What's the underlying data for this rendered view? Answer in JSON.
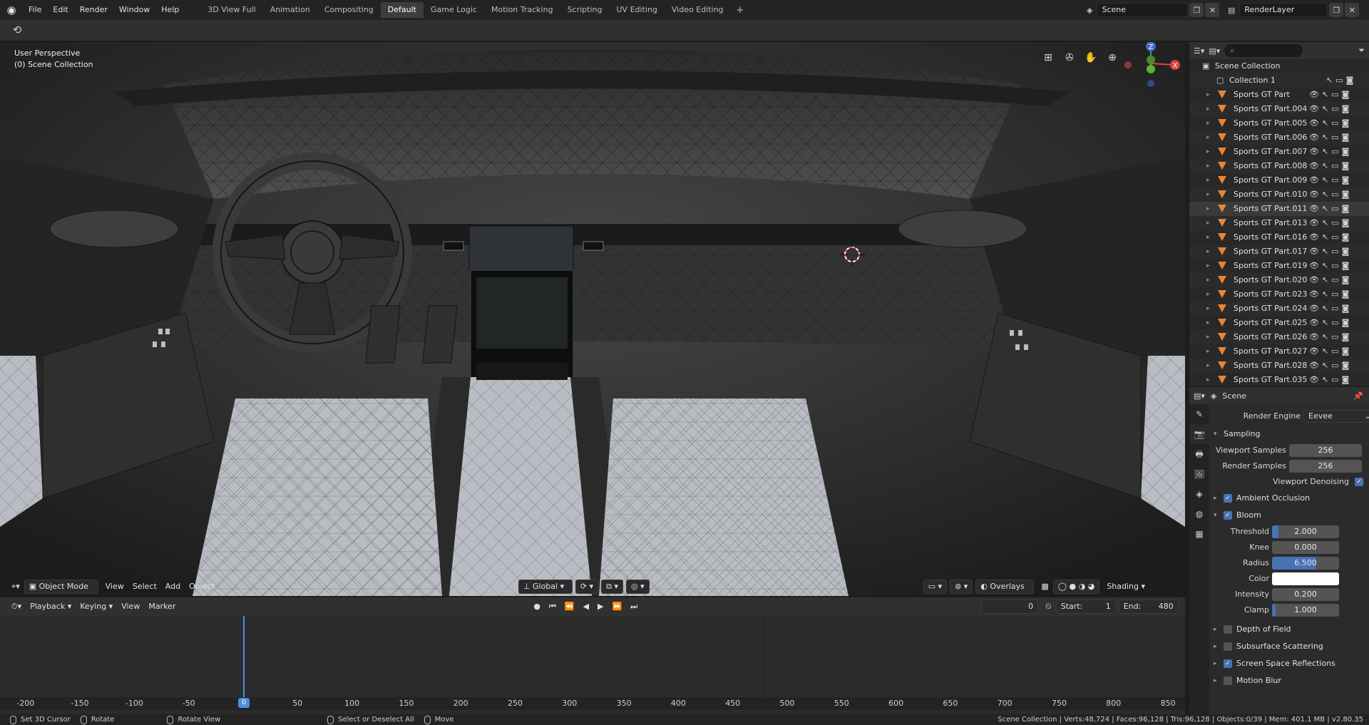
{
  "menus": [
    "File",
    "Edit",
    "Render",
    "Window",
    "Help"
  ],
  "workspaces": [
    "3D View Full",
    "Animation",
    "Compositing",
    "Default",
    "Game Logic",
    "Motion Tracking",
    "Scripting",
    "UV Editing",
    "Video Editing"
  ],
  "active_workspace": "Default",
  "scene_field": "Scene",
  "render_layer_field": "RenderLayer",
  "viewport": {
    "perspective_label": "User Perspective",
    "collection_label": "(0) Scene Collection",
    "mode": "Object Mode",
    "menus": [
      "View",
      "Select",
      "Add",
      "Object"
    ],
    "transform_orientation": "Global",
    "overlays_label": "Overlays",
    "shading_label": "Shading",
    "gizmo_axes": {
      "x": "X",
      "y": "Y",
      "z": "Z"
    }
  },
  "timeline": {
    "menus": [
      "Playback",
      "Keying",
      "View",
      "Marker"
    ],
    "current_frame": "0",
    "start_label": "Start:",
    "start": "1",
    "end_label": "End:",
    "end": "480",
    "ruler_ticks": [
      "-200",
      "-150",
      "-100",
      "-50",
      "0",
      "50",
      "100",
      "150",
      "200",
      "250",
      "300",
      "350",
      "400",
      "450",
      "500",
      "550",
      "600",
      "650",
      "700",
      "750",
      "800",
      "850"
    ],
    "playhead_value": 0
  },
  "outliner": {
    "search_placeholder": "",
    "root": "Scene Collection",
    "collection": "Collection 1",
    "objects": [
      "Sports GT Part",
      "Sports GT Part.004",
      "Sports GT Part.005",
      "Sports GT Part.006",
      "Sports GT Part.007",
      "Sports GT Part.008",
      "Sports GT Part.009",
      "Sports GT Part.010",
      "Sports GT Part.011",
      "Sports GT Part.013",
      "Sports GT Part.016",
      "Sports GT Part.017",
      "Sports GT Part.019",
      "Sports GT Part.020",
      "Sports GT Part.023",
      "Sports GT Part.024",
      "Sports GT Part.025",
      "Sports GT Part.026",
      "Sports GT Part.027",
      "Sports GT Part.028",
      "Sports GT Part.035"
    ],
    "selected": "Sports GT Part.011"
  },
  "properties": {
    "context": "Scene",
    "render_engine_label": "Render Engine",
    "render_engine": "Eevee",
    "sampling_label": "Sampling",
    "viewport_samples_label": "Viewport Samples",
    "viewport_samples": "256",
    "render_samples_label": "Render Samples",
    "render_samples": "256",
    "viewport_denoising_label": "Viewport Denoising",
    "ambient_occlusion_label": "Ambient Occlusion",
    "bloom_label": "Bloom",
    "threshold_label": "Threshold",
    "threshold": "2.000",
    "knee_label": "Knee",
    "knee": "0.000",
    "radius_label": "Radius",
    "radius": "6.500",
    "radius_fill": 0.65,
    "threshold_fill": 0.1,
    "intensity_label": "Intensity",
    "intensity": "0.200",
    "clamp_label": "Clamp",
    "clamp": "1.000",
    "clamp_fill": 0.05,
    "color_label": "Color",
    "bloom_color": "#ffffff",
    "dof_label": "Depth of Field",
    "sss_label": "Subsurface Scattering",
    "ssr_label": "Screen Space Reflections",
    "motion_blur_label": "Motion Blur"
  },
  "status": {
    "set_cursor": "Set 3D Cursor",
    "rotate": "Rotate",
    "rotate_view": "Rotate View",
    "select_all": "Select or Deselect All",
    "move": "Move",
    "stats": "Scene Collection | Verts:48,724 | Faces:96,128 | Tris:96,128 | Objects:0/39 | Mem: 401.1 MB | v2.80.35"
  },
  "colors": {
    "accent": "#4772b3",
    "object_icon": "#e5863a",
    "playhead": "#4c8ed9"
  }
}
